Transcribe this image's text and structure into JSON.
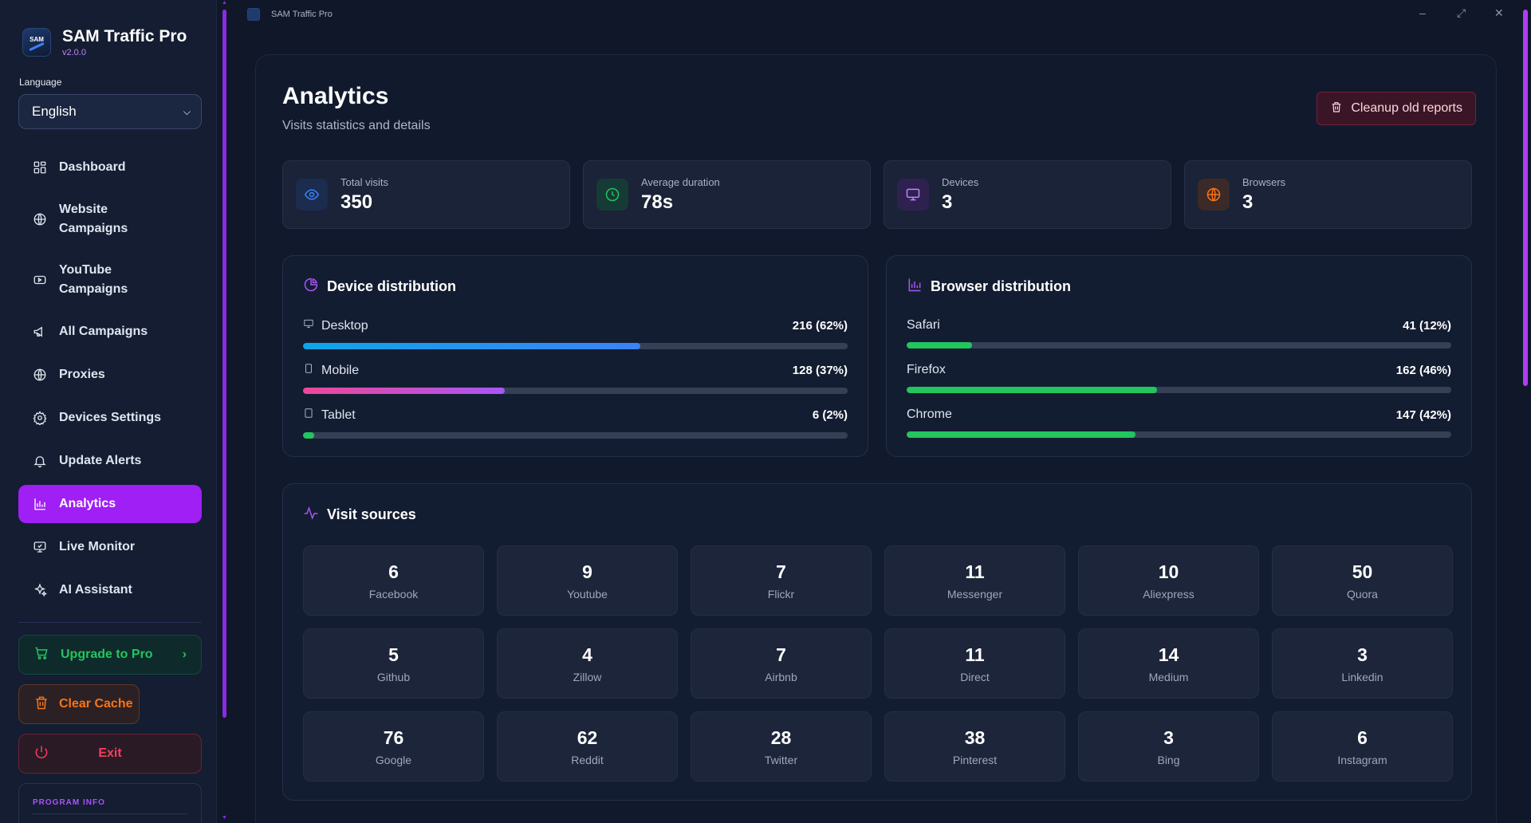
{
  "app": {
    "title": "SAM Traffic Pro",
    "version": "v2.0.0",
    "logo_text": "SAM",
    "window_title": "SAM Traffic Pro"
  },
  "sidebar": {
    "language_label": "Language",
    "language_value": "English",
    "nav": [
      {
        "label": "Dashboard",
        "icon": "grid-icon"
      },
      {
        "label": "Website Campaigns",
        "icon": "globe-icon"
      },
      {
        "label": "YouTube Campaigns",
        "icon": "youtube-icon"
      },
      {
        "label": "All Campaigns",
        "icon": "megaphone-icon"
      },
      {
        "label": "Proxies",
        "icon": "globe-icon"
      },
      {
        "label": "Devices Settings",
        "icon": "gear-icon"
      },
      {
        "label": "Update Alerts",
        "icon": "bell-icon"
      },
      {
        "label": "Analytics",
        "icon": "bar-chart-icon",
        "active": true
      },
      {
        "label": "Live Monitor",
        "icon": "monitor-icon"
      },
      {
        "label": "AI Assistant",
        "icon": "sparkles-icon"
      }
    ],
    "upgrade_label": "Upgrade to Pro",
    "clear_cache_label": "Clear Cache",
    "exit_label": "Exit",
    "program_info_label": "PROGRAM INFO"
  },
  "page": {
    "title": "Analytics",
    "subtitle": "Visits statistics and details",
    "cleanup_label": "Cleanup old reports"
  },
  "stats": [
    {
      "label": "Total visits",
      "value": "350",
      "icon": "eye-icon",
      "color": "#3b82f6",
      "bg": "#1b2c4e"
    },
    {
      "label": "Average duration",
      "value": "78s",
      "icon": "clock-icon",
      "color": "#22c55e",
      "bg": "#163a36"
    },
    {
      "label": "Devices",
      "value": "3",
      "icon": "monitor-icon",
      "color": "#c084fc",
      "bg": "#2e2150"
    },
    {
      "label": "Browsers",
      "value": "3",
      "icon": "globe-icon",
      "color": "#f97316",
      "bg": "#3b2a27"
    }
  ],
  "device_distribution": {
    "title": "Device distribution",
    "rows": [
      {
        "name": "Desktop",
        "value": "216 (62%)",
        "fraction": 0.62,
        "color": "#0ea5e9",
        "icon": "desktop-icon"
      },
      {
        "name": "Mobile",
        "value": "128 (37%)",
        "fraction": 0.37,
        "color": "#ec4899",
        "icon": "mobile-icon"
      },
      {
        "name": "Tablet",
        "value": "6 (2%)",
        "fraction": 0.02,
        "color": "#22c55e",
        "icon": "tablet-icon"
      }
    ]
  },
  "browser_distribution": {
    "title": "Browser distribution",
    "rows": [
      {
        "name": "Safari",
        "value": "41 (12%)",
        "fraction": 0.12,
        "color": "#22c55e"
      },
      {
        "name": "Firefox",
        "value": "162 (46%)",
        "fraction": 0.46,
        "color": "#22c55e"
      },
      {
        "name": "Chrome",
        "value": "147 (42%)",
        "fraction": 0.42,
        "color": "#22c55e"
      }
    ]
  },
  "visit_sources": {
    "title": "Visit sources",
    "items": [
      {
        "n": "6",
        "label": "Facebook"
      },
      {
        "n": "9",
        "label": "Youtube"
      },
      {
        "n": "7",
        "label": "Flickr"
      },
      {
        "n": "11",
        "label": "Messenger"
      },
      {
        "n": "10",
        "label": "Aliexpress"
      },
      {
        "n": "50",
        "label": "Quora"
      },
      {
        "n": "5",
        "label": "Github"
      },
      {
        "n": "4",
        "label": "Zillow"
      },
      {
        "n": "7",
        "label": "Airbnb"
      },
      {
        "n": "11",
        "label": "Direct"
      },
      {
        "n": "14",
        "label": "Medium"
      },
      {
        "n": "3",
        "label": "Linkedin"
      },
      {
        "n": "76",
        "label": "Google"
      },
      {
        "n": "62",
        "label": "Reddit"
      },
      {
        "n": "28",
        "label": "Twitter"
      },
      {
        "n": "38",
        "label": "Pinterest"
      },
      {
        "n": "3",
        "label": "Bing"
      },
      {
        "n": "6",
        "label": "Instagram"
      }
    ]
  }
}
